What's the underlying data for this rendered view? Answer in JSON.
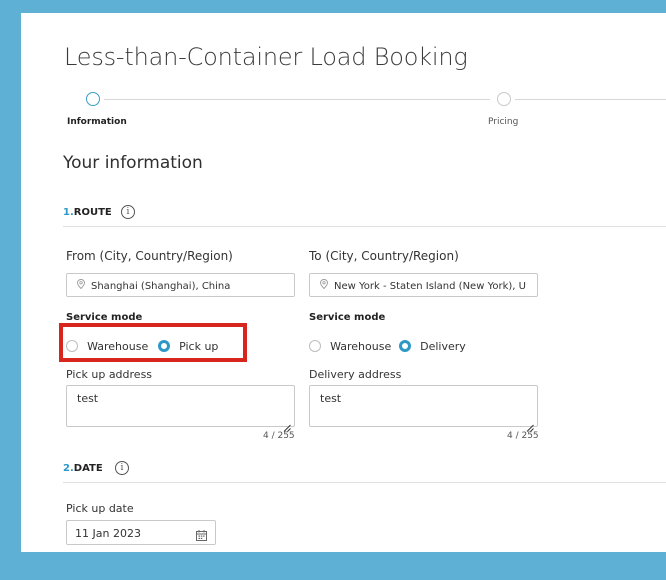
{
  "page": {
    "title": "Less-than-Container Load Booking"
  },
  "stepper": {
    "steps": [
      {
        "label": "Information",
        "active": true
      },
      {
        "label": "Pricing",
        "active": false
      }
    ]
  },
  "section": {
    "title": "Your information"
  },
  "route": {
    "number": "1.",
    "heading": "ROUTE",
    "info_icon": "i",
    "from": {
      "label": "From (City, Country/Region)",
      "value": "Shanghai (Shanghai), China",
      "service_mode_label": "Service mode",
      "options": [
        "Warehouse",
        "Pick up"
      ],
      "selected": "Pick up",
      "address_label": "Pick up address",
      "address_value": "test",
      "counter": "4 / 255"
    },
    "to": {
      "label": "To (City, Country/Region)",
      "value": "New York - Staten Island (New York), U",
      "service_mode_label": "Service mode",
      "options": [
        "Warehouse",
        "Delivery"
      ],
      "selected": "Delivery",
      "address_label": "Delivery address",
      "address_value": "test",
      "counter": "4 / 255"
    }
  },
  "date": {
    "number": "2.",
    "heading": "DATE",
    "info_icon": "i",
    "pickup_label": "Pick up date",
    "pickup_value": "11 Jan 2023"
  },
  "colors": {
    "accent": "#2e98c6",
    "highlight": "#d7261e",
    "frame": "#5fb0d5"
  },
  "icons": [
    "location-pin-icon",
    "info-icon",
    "calendar-icon",
    "resize-grip-icon"
  ]
}
